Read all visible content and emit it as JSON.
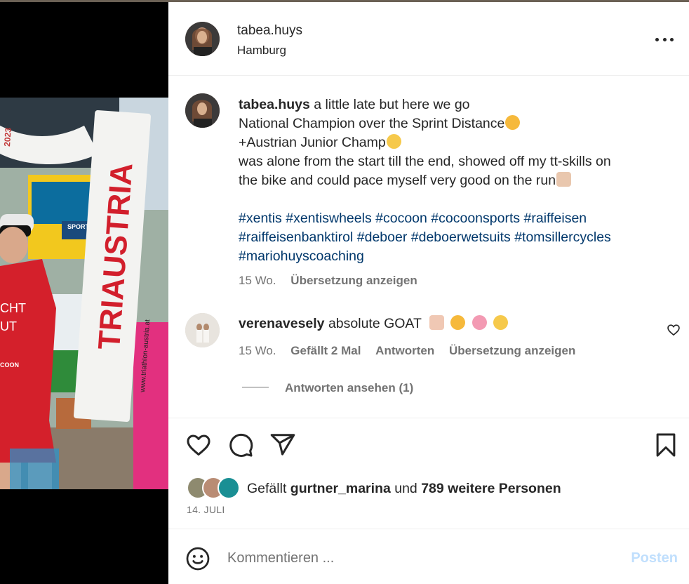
{
  "header": {
    "username": "tabea.huys",
    "location": "Hamburg"
  },
  "caption": {
    "username": "tabea.huys",
    "line1": " a little late but here we go",
    "line2": "National Champion over the Sprint Distance",
    "line3": "+Austrian Junior Champ",
    "line4": "was alone from the start till the end, showed off my tt-skills on",
    "line5": "the bike and could pace myself very good on the run",
    "hashtags_line1": [
      "#xentis",
      "#xentiswheels",
      "#cocoon",
      "#cocoonsports",
      "#raiffeisen"
    ],
    "hashtags_line2": [
      "#raiffeisenbanktirol",
      "#deboer",
      "#deboerwetsuits",
      "#tomsillercycles"
    ],
    "hashtags_line3": [
      "#mariohuyscoaching"
    ],
    "age": "15 Wo.",
    "translate_label": "Übersetzung anzeigen"
  },
  "comment": {
    "username": "verenavesely",
    "text": " absolute GOAT",
    "age": "15 Wo.",
    "likes_label": "Gefällt 2 Mal",
    "reply_label": "Antworten",
    "translate_label": "Übersetzung anzeigen",
    "view_replies_label": "Antworten ansehen (1)"
  },
  "likes": {
    "prefix": "Gefällt ",
    "user": "gurtner_marina",
    "middle": " und ",
    "count_label": "789 weitere Personen"
  },
  "date": "14. JULI",
  "comment_bar": {
    "placeholder": "Kommentieren ...",
    "post_label": "Posten"
  },
  "photo": {
    "banner_text": "TRIAUSTRIA",
    "banner_url": "www.triathlon-austria.at",
    "banner_year": "2023",
    "sign_text": "SPORT LAND",
    "suit_text_1": "CHT",
    "suit_text_2": "UT",
    "suit_text_3": "COON"
  },
  "colors": {
    "link": "#00376b",
    "muted": "#737373",
    "post_disabled": "#c0dffd",
    "divider": "#efefef"
  },
  "icons": {
    "more": "more-horizontal-icon",
    "heart": "heart-icon",
    "comment": "comment-icon",
    "share": "share-icon",
    "save": "bookmark-icon",
    "emoji": "emoji-icon"
  }
}
